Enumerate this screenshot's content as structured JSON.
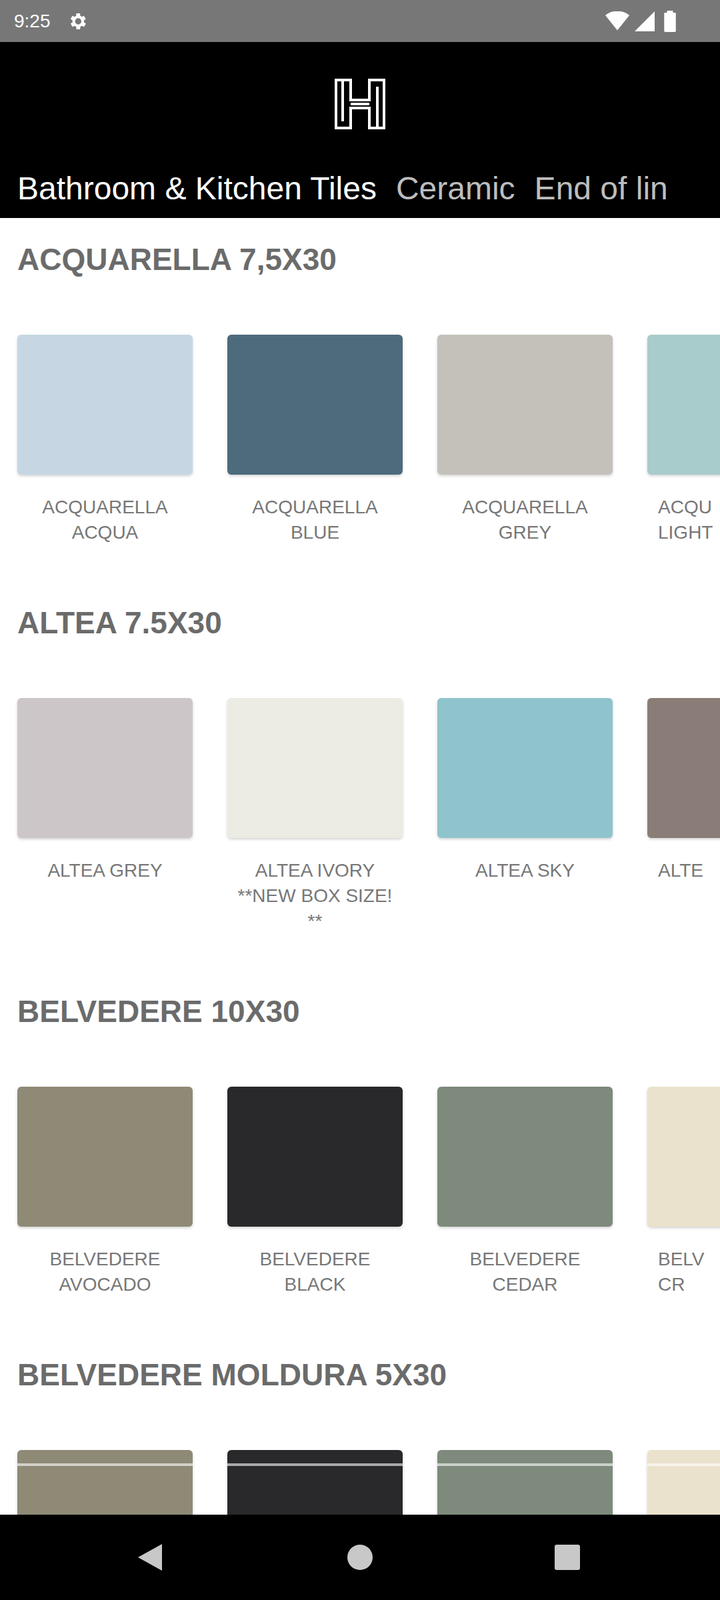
{
  "status_bar": {
    "time": "9:25"
  },
  "tabs": [
    {
      "label": "Bathroom & Kitchen Tiles",
      "selected": true
    },
    {
      "label": "Ceramic",
      "selected": false
    },
    {
      "label": "End of lin",
      "selected": false
    }
  ],
  "sections": [
    {
      "title": "ACQUARELLA 7,5X30",
      "kind": "flat",
      "items": [
        {
          "label": "ACQUARELLA ACQUA",
          "color": "#c6d7e3",
          "kind": "full"
        },
        {
          "label": "ACQUARELLA BLUE",
          "color": "#4e6a7d",
          "kind": "full"
        },
        {
          "label": "ACQUARELLA GREY",
          "color": "#c4c1ba",
          "kind": "full"
        },
        {
          "label": "ACQU LIGHT",
          "color": "#a8cbcb",
          "kind": "partial"
        }
      ]
    },
    {
      "title": "ALTEA 7.5X30",
      "kind": "flat",
      "items": [
        {
          "label": "ALTEA GREY",
          "color": "#ccc6c9",
          "kind": "full"
        },
        {
          "label": "ALTEA IVORY **NEW BOX SIZE! **",
          "color": "#edece4",
          "kind": "full"
        },
        {
          "label": "ALTEA SKY",
          "color": "#8fc4cc",
          "kind": "full"
        },
        {
          "label": "ALTE",
          "color": "#8a7c76",
          "kind": "partial"
        }
      ]
    },
    {
      "title": "BELVEDERE 10X30",
      "kind": "flat",
      "items": [
        {
          "label": "BELVEDERE AVOCADO",
          "color": "#8f8a76",
          "kind": "full"
        },
        {
          "label": "BELVEDERE BLACK",
          "color": "#29282b",
          "kind": "full"
        },
        {
          "label": "BELVEDERE CEDAR",
          "color": "#7d8a7c",
          "kind": "full"
        },
        {
          "label": "BELV CR",
          "color": "#ebe2cd",
          "kind": "partial"
        }
      ]
    },
    {
      "title": "BELVEDERE MOLDURA 5X30",
      "kind": "moldura",
      "items": [
        {
          "label": "",
          "color": "#8f8a76",
          "kind": "full"
        },
        {
          "label": "",
          "color": "#29282b",
          "kind": "full"
        },
        {
          "label": "",
          "color": "#7d8a7c",
          "kind": "full"
        },
        {
          "label": "",
          "color": "#ebe2cd",
          "kind": "partial"
        }
      ]
    }
  ]
}
